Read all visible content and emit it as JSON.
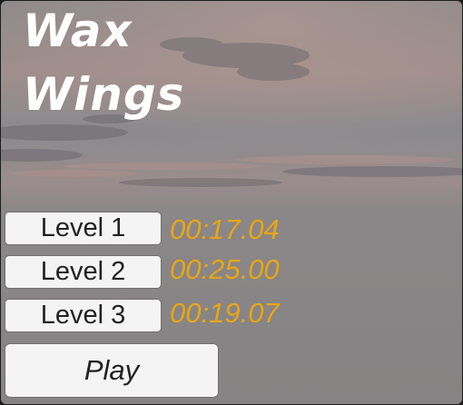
{
  "game": {
    "title_line1": "Wax",
    "title_line2": "Wings"
  },
  "levels": [
    {
      "label": "Level 1",
      "best_time": "00:17.04"
    },
    {
      "label": "Level 2",
      "best_time": "00:25.00"
    },
    {
      "label": "Level 3",
      "best_time": "00:19.07"
    }
  ],
  "play": {
    "label": "Play"
  },
  "colors": {
    "time_text": "#e8a515",
    "button_bg": "#f4f4f4",
    "title_text": "#ffffff"
  }
}
